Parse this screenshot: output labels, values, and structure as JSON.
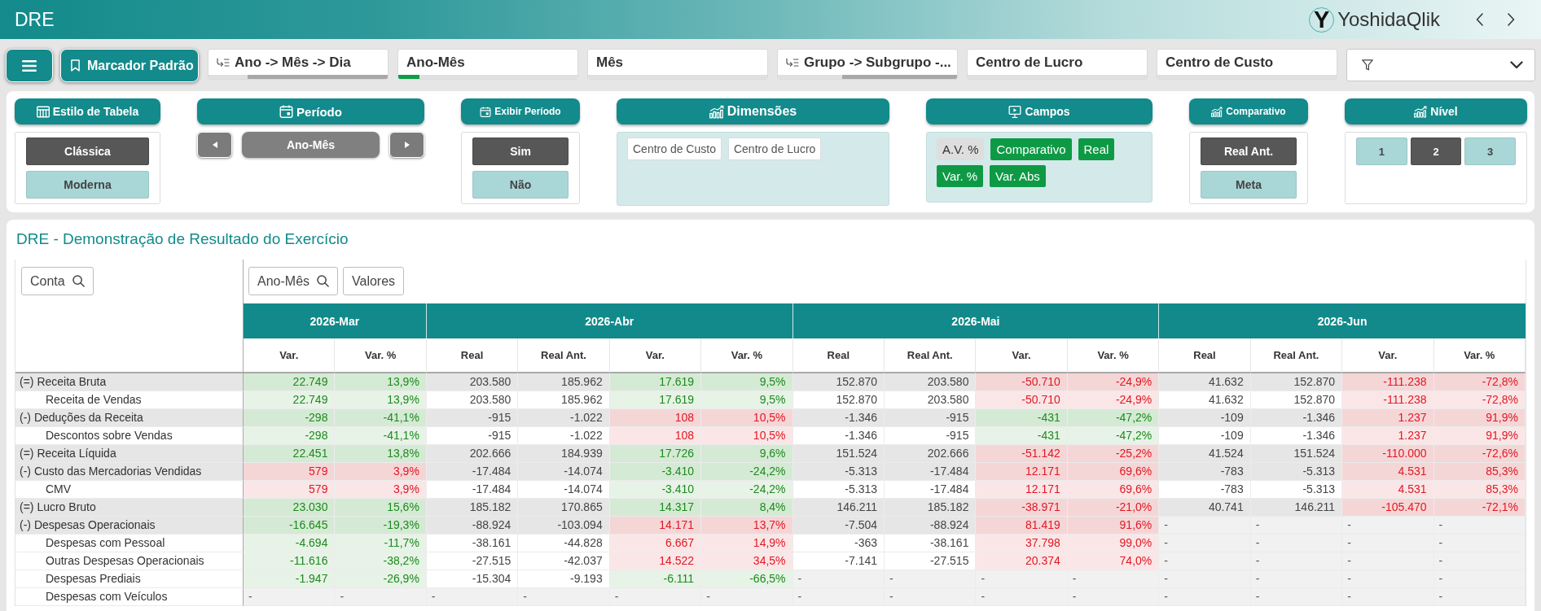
{
  "app_bar": {
    "title": "DRE",
    "logo": {
      "mark": "Y",
      "name": "YoshidaQlik"
    }
  },
  "toolbar": {
    "bookmark": "Marcador Padrão",
    "filters": [
      {
        "label": "Ano -> Mês -> Dia",
        "drill": true,
        "segments": [
          {
            "kind": "alternative",
            "level": 0.22
          },
          {
            "kind": "excluded",
            "level": 0.78
          }
        ]
      },
      {
        "label": "Ano-Mês",
        "drill": false,
        "segments": [
          {
            "kind": "selected",
            "level": 0.12
          },
          {
            "kind": "alternative",
            "level": 0.88
          }
        ]
      },
      {
        "label": "Mês",
        "drill": false,
        "segments": [
          {
            "kind": "alternative",
            "level": 1
          }
        ]
      },
      {
        "label": "Grupo -> Subgrupo -...",
        "drill": true,
        "segments": [
          {
            "kind": "alternative",
            "level": 0.36
          },
          {
            "kind": "excluded",
            "level": 0.64
          }
        ]
      },
      {
        "label": "Centro de Lucro",
        "drill": false,
        "segments": [
          {
            "kind": "alternative",
            "level": 1
          }
        ]
      },
      {
        "label": "Centro de Custo",
        "drill": false,
        "segments": [
          {
            "kind": "alternative",
            "level": 1
          }
        ]
      }
    ]
  },
  "controls": [
    {
      "kind": "options",
      "title": "Estilo de Tabela",
      "options": [
        {
          "label": "Clássica",
          "selected": true
        },
        {
          "label": "Moderna",
          "selected": false
        }
      ]
    },
    {
      "kind": "stepper",
      "title": "Período",
      "value": "Ano-Mês"
    },
    {
      "kind": "options",
      "title": "Exibir Período",
      "options": [
        {
          "label": "Sim",
          "selected": true
        },
        {
          "label": "Não",
          "selected": false
        }
      ]
    },
    {
      "kind": "tags",
      "title": "Dimensões",
      "tags": [
        "Centro de Custo",
        "Centro de Lucro"
      ]
    },
    {
      "kind": "toggles",
      "title": "Campos",
      "toggles": [
        {
          "label": "A.V. %",
          "selected": false
        },
        {
          "label": "Comparativo",
          "selected": true
        },
        {
          "label": "Real",
          "selected": true
        },
        {
          "label": "Var. %",
          "selected": true
        },
        {
          "label": "Var. Abs",
          "selected": true
        }
      ]
    },
    {
      "kind": "options",
      "title": "Comparativo",
      "options": [
        {
          "label": "Real Ant.",
          "selected": true
        },
        {
          "label": "Meta",
          "selected": false
        }
      ]
    },
    {
      "kind": "levels",
      "title": "Nível",
      "options": [
        {
          "label": "1",
          "selected": false
        },
        {
          "label": "2",
          "selected": true
        },
        {
          "label": "3",
          "selected": false
        }
      ]
    }
  ],
  "report": {
    "title": "DRE - Demonstração de Resultado do Exercício",
    "row_field": {
      "label": "Conta",
      "searchable": true
    },
    "column_fields": [
      {
        "label": "Ano-Mês",
        "searchable": true
      },
      {
        "label": "Valores",
        "searchable": false
      }
    ],
    "periods": [
      {
        "label": "2026-Mar",
        "columns": [
          {
            "label": "Var.",
            "kind": "variance"
          },
          {
            "label": "Var. %",
            "kind": "variance"
          }
        ]
      },
      {
        "label": "2026-Abr",
        "columns": [
          {
            "label": "Real",
            "kind": "amount"
          },
          {
            "label": "Real Ant.",
            "kind": "amount"
          },
          {
            "label": "Var.",
            "kind": "variance"
          },
          {
            "label": "Var. %",
            "kind": "variance"
          }
        ]
      },
      {
        "label": "2026-Mai",
        "columns": [
          {
            "label": "Real",
            "kind": "amount"
          },
          {
            "label": "Real Ant.",
            "kind": "amount"
          },
          {
            "label": "Var.",
            "kind": "variance"
          },
          {
            "label": "Var. %",
            "kind": "variance"
          }
        ]
      },
      {
        "label": "2026-Jun",
        "columns": [
          {
            "label": "Real",
            "kind": "amount"
          },
          {
            "label": "Real Ant.",
            "kind": "amount"
          },
          {
            "label": "Var.",
            "kind": "variance"
          },
          {
            "label": "Var. %",
            "kind": "variance"
          }
        ]
      }
    ],
    "rows": [
      {
        "label": "(=) Receita Bruta",
        "periods": [
          {
            "kind": "values",
            "favorable": true,
            "values": [
              "22.749",
              "13,9%"
            ]
          },
          {
            "kind": "values",
            "favorable": true,
            "values": [
              "203.580",
              "185.962",
              "17.619",
              "9,5%"
            ]
          },
          {
            "kind": "values",
            "favorable": false,
            "values": [
              "152.870",
              "203.580",
              "-50.710",
              "-24,9%"
            ]
          },
          {
            "kind": "values",
            "favorable": false,
            "values": [
              "41.632",
              "152.870",
              "-111.238",
              "-72,8%"
            ]
          }
        ],
        "children": [
          {
            "label": "Receita de Vendas",
            "periods": [
              {
                "kind": "values",
                "favorable": true,
                "values": [
                  "22.749",
                  "13,9%"
                ]
              },
              {
                "kind": "values",
                "favorable": true,
                "values": [
                  "203.580",
                  "185.962",
                  "17.619",
                  "9,5%"
                ]
              },
              {
                "kind": "values",
                "favorable": false,
                "values": [
                  "152.870",
                  "203.580",
                  "-50.710",
                  "-24,9%"
                ]
              },
              {
                "kind": "values",
                "favorable": false,
                "values": [
                  "41.632",
                  "152.870",
                  "-111.238",
                  "-72,8%"
                ]
              }
            ]
          }
        ]
      },
      {
        "label": "(-) Deduções da Receita",
        "periods": [
          {
            "kind": "values",
            "favorable": true,
            "values": [
              "-298",
              "-41,1%"
            ]
          },
          {
            "kind": "values",
            "favorable": false,
            "values": [
              "-915",
              "-1.022",
              "108",
              "10,5%"
            ]
          },
          {
            "kind": "values",
            "favorable": true,
            "values": [
              "-1.346",
              "-915",
              "-431",
              "-47,2%"
            ]
          },
          {
            "kind": "values",
            "favorable": false,
            "values": [
              "-109",
              "-1.346",
              "1.237",
              "91,9%"
            ]
          }
        ],
        "children": [
          {
            "label": "Descontos sobre Vendas",
            "periods": [
              {
                "kind": "values",
                "favorable": true,
                "values": [
                  "-298",
                  "-41,1%"
                ]
              },
              {
                "kind": "values",
                "favorable": false,
                "values": [
                  "-915",
                  "-1.022",
                  "108",
                  "10,5%"
                ]
              },
              {
                "kind": "values",
                "favorable": true,
                "values": [
                  "-1.346",
                  "-915",
                  "-431",
                  "-47,2%"
                ]
              },
              {
                "kind": "values",
                "favorable": false,
                "values": [
                  "-109",
                  "-1.346",
                  "1.237",
                  "91,9%"
                ]
              }
            ]
          }
        ]
      },
      {
        "label": "(=) Receita Líquida",
        "periods": [
          {
            "kind": "values",
            "favorable": true,
            "values": [
              "22.451",
              "13,8%"
            ]
          },
          {
            "kind": "values",
            "favorable": true,
            "values": [
              "202.666",
              "184.939",
              "17.726",
              "9,6%"
            ]
          },
          {
            "kind": "values",
            "favorable": false,
            "values": [
              "151.524",
              "202.666",
              "-51.142",
              "-25,2%"
            ]
          },
          {
            "kind": "values",
            "favorable": false,
            "values": [
              "41.524",
              "151.524",
              "-110.000",
              "-72,6%"
            ]
          }
        ]
      },
      {
        "label": "(-) Custo das Mercadorias Vendidas",
        "periods": [
          {
            "kind": "values",
            "favorable": false,
            "values": [
              "579",
              "3,9%"
            ]
          },
          {
            "kind": "values",
            "favorable": true,
            "values": [
              "-17.484",
              "-14.074",
              "-3.410",
              "-24,2%"
            ]
          },
          {
            "kind": "values",
            "favorable": false,
            "values": [
              "-5.313",
              "-17.484",
              "12.171",
              "69,6%"
            ]
          },
          {
            "kind": "values",
            "favorable": false,
            "values": [
              "-783",
              "-5.313",
              "4.531",
              "85,3%"
            ]
          }
        ],
        "children": [
          {
            "label": "CMV",
            "periods": [
              {
                "kind": "values",
                "favorable": false,
                "values": [
                  "579",
                  "3,9%"
                ]
              },
              {
                "kind": "values",
                "favorable": true,
                "values": [
                  "-17.484",
                  "-14.074",
                  "-3.410",
                  "-24,2%"
                ]
              },
              {
                "kind": "values",
                "favorable": false,
                "values": [
                  "-5.313",
                  "-17.484",
                  "12.171",
                  "69,6%"
                ]
              },
              {
                "kind": "values",
                "favorable": false,
                "values": [
                  "-783",
                  "-5.313",
                  "4.531",
                  "85,3%"
                ]
              }
            ]
          }
        ]
      },
      {
        "label": "(=) Lucro Bruto",
        "periods": [
          {
            "kind": "values",
            "favorable": true,
            "values": [
              "23.030",
              "15,6%"
            ]
          },
          {
            "kind": "values",
            "favorable": true,
            "values": [
              "185.182",
              "170.865",
              "14.317",
              "8,4%"
            ]
          },
          {
            "kind": "values",
            "favorable": false,
            "values": [
              "146.211",
              "185.182",
              "-38.971",
              "-21,0%"
            ]
          },
          {
            "kind": "values",
            "favorable": false,
            "values": [
              "40.741",
              "146.211",
              "-105.470",
              "-72,1%"
            ]
          }
        ]
      },
      {
        "label": "(-) Despesas Operacionais",
        "periods": [
          {
            "kind": "values",
            "favorable": true,
            "values": [
              "-16.645",
              "-19,3%"
            ]
          },
          {
            "kind": "values",
            "favorable": false,
            "values": [
              "-88.924",
              "-103.094",
              "14.171",
              "13,7%"
            ]
          },
          {
            "kind": "values",
            "favorable": false,
            "values": [
              "-7.504",
              "-88.924",
              "81.419",
              "91,6%"
            ]
          },
          {
            "kind": "empty",
            "values": [
              "-",
              "-",
              "-",
              "-"
            ]
          }
        ],
        "children": [
          {
            "label": "Despesas com Pessoal",
            "periods": [
              {
                "kind": "values",
                "favorable": true,
                "values": [
                  "-4.694",
                  "-11,7%"
                ]
              },
              {
                "kind": "values",
                "favorable": false,
                "values": [
                  "-38.161",
                  "-44.828",
                  "6.667",
                  "14,9%"
                ]
              },
              {
                "kind": "values",
                "favorable": false,
                "values": [
                  "-363",
                  "-38.161",
                  "37.798",
                  "99,0%"
                ]
              },
              {
                "kind": "empty",
                "values": [
                  "-",
                  "-",
                  "-",
                  "-"
                ]
              }
            ]
          },
          {
            "label": "Outras Despesas Operacionais",
            "periods": [
              {
                "kind": "values",
                "favorable": true,
                "values": [
                  "-11.616",
                  "-38,2%"
                ]
              },
              {
                "kind": "values",
                "favorable": false,
                "values": [
                  "-27.515",
                  "-42.037",
                  "14.522",
                  "34,5%"
                ]
              },
              {
                "kind": "values",
                "favorable": false,
                "values": [
                  "-7.141",
                  "-27.515",
                  "20.374",
                  "74,0%"
                ]
              },
              {
                "kind": "empty",
                "values": [
                  "-",
                  "-",
                  "-",
                  "-"
                ]
              }
            ]
          },
          {
            "label": "Despesas Prediais",
            "periods": [
              {
                "kind": "values",
                "favorable": true,
                "values": [
                  "-1.947",
                  "-26,9%"
                ]
              },
              {
                "kind": "values",
                "favorable": true,
                "values": [
                  "-15.304",
                  "-9.193",
                  "-6.111",
                  "-66,5%"
                ]
              },
              {
                "kind": "empty",
                "values": [
                  "-",
                  "-",
                  "-",
                  "-"
                ]
              },
              {
                "kind": "empty",
                "values": [
                  "-",
                  "-",
                  "-",
                  "-"
                ]
              }
            ]
          },
          {
            "label": "Despesas com Veículos",
            "periods": [
              {
                "kind": "empty",
                "values": [
                  "-",
                  "-"
                ]
              },
              {
                "kind": "empty",
                "values": [
                  "-",
                  "-",
                  "-",
                  "-"
                ]
              },
              {
                "kind": "empty",
                "values": [
                  "-",
                  "-",
                  "-",
                  "-"
                ]
              },
              {
                "kind": "empty",
                "values": [
                  "-",
                  "-",
                  "-",
                  "-"
                ]
              }
            ]
          }
        ]
      }
    ]
  }
}
